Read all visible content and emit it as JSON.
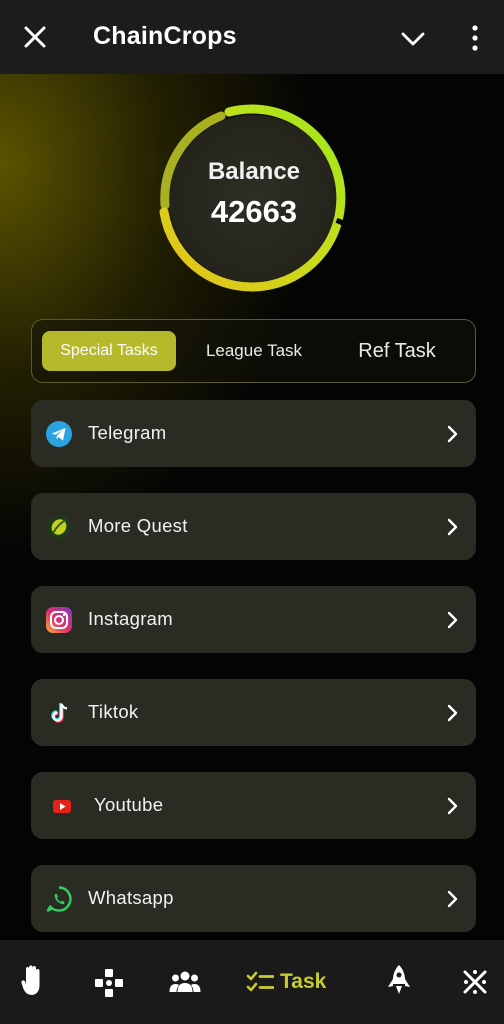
{
  "header": {
    "title": "ChainCrops",
    "close_icon": "close-icon",
    "dropdown_icon": "chevron-down-icon",
    "menu_icon": "more-vertical-icon"
  },
  "balance": {
    "label": "Balance",
    "value": "42663",
    "ring_colors": [
      "#d8d21a",
      "#a8e21a"
    ]
  },
  "tabs": [
    {
      "label": "Special Tasks",
      "active": true
    },
    {
      "label": "League Task",
      "active": false
    },
    {
      "label": "Ref Task",
      "active": false
    }
  ],
  "tasks": [
    {
      "label": "Telegram",
      "icon": "telegram-icon"
    },
    {
      "label": "More Quest",
      "icon": "quest-icon"
    },
    {
      "label": "Instagram",
      "icon": "instagram-icon"
    },
    {
      "label": "Tiktok",
      "icon": "tiktok-icon"
    },
    {
      "label": "Youtube",
      "icon": "youtube-icon"
    },
    {
      "label": "Whatsapp",
      "icon": "whatsapp-icon"
    }
  ],
  "bottom_nav": {
    "items": [
      "tap-hand-icon",
      "gamepad-icon",
      "friends-icon",
      "task-icon",
      "rocket-icon",
      "cross-pattern-icon"
    ],
    "active_label": "Task"
  },
  "colors": {
    "accent": "#b7b92d",
    "accent_text": "#c9cc2b",
    "card": "#2a2c24"
  }
}
